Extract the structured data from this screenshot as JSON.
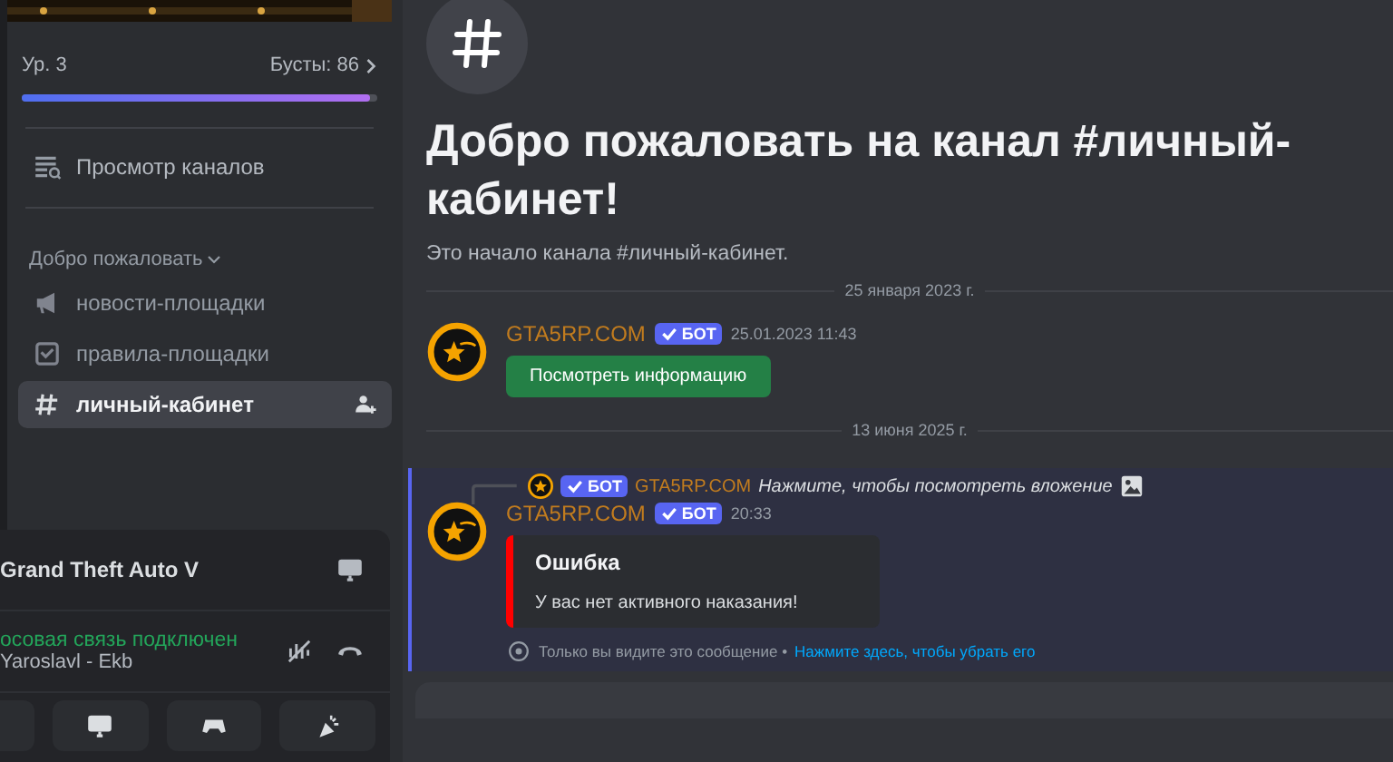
{
  "server": {
    "rank": "Ур. 3",
    "boosts": "Бусты: 86",
    "boost_bar": {
      "level": 0.98
    }
  },
  "browse_label": "Просмотр каналов",
  "category": {
    "label": "Добро пожаловать",
    "expanded": true
  },
  "channels": [
    {
      "name": "новости-площадки",
      "kind": "announcement",
      "selected": false
    },
    {
      "name": "правила-площадки",
      "kind": "rules",
      "selected": false
    },
    {
      "name": "личный-кабинет",
      "kind": "text",
      "selected": true
    }
  ],
  "activity": {
    "game": "Grand Theft Auto V"
  },
  "voice": {
    "status": "осовая связь подключен",
    "channel": "Yaroslavl - Ekb"
  },
  "welcome": {
    "title": "Добро пожаловать на канал #личный-кабинет!",
    "subtitle": "Это начало канала #личный-кабинет."
  },
  "messages": [
    {
      "kind": "date",
      "text": "25 января 2023 г."
    },
    {
      "kind": "message",
      "highlighted": false,
      "author": "GTA5RP.COM",
      "badge": "БОТ",
      "time": "25.01.2023 11:43",
      "button": "Посмотреть информацию"
    },
    {
      "kind": "date",
      "text": "13 июня 2025 г."
    },
    {
      "kind": "message",
      "highlighted": true,
      "reply": {
        "badge": "БОТ",
        "author": "GTA5RP.COM",
        "text": "Нажмите, чтобы посмотреть вложение"
      },
      "author": "GTA5RP.COM",
      "badge": "БОТ",
      "time": "20:33",
      "embed": {
        "title": "Ошибка",
        "description": "У вас нет активного наказания!"
      },
      "ephemeral": {
        "note": "Только вы видите это сообщение •",
        "link": "Нажмите здесь, чтобы убрать его"
      }
    }
  ]
}
